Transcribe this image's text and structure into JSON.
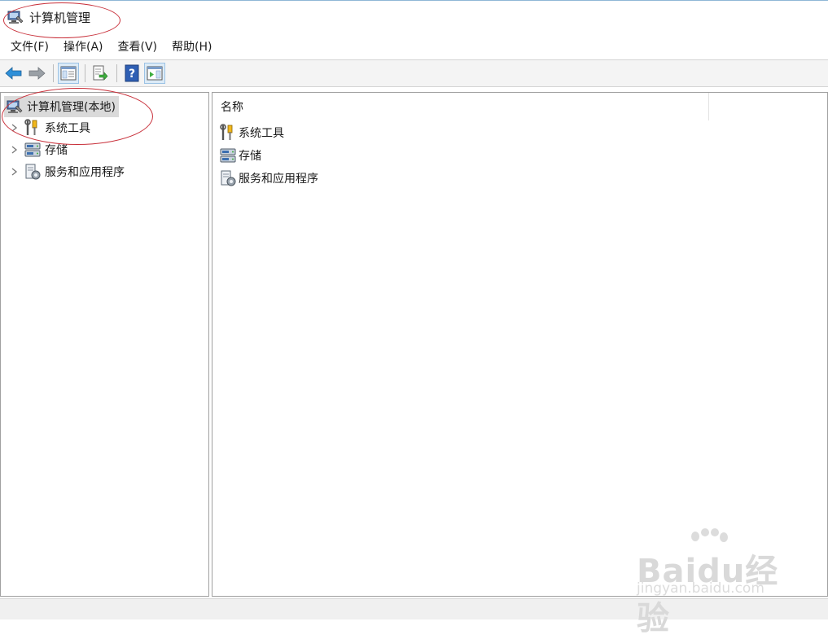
{
  "window": {
    "title": "计算机管理"
  },
  "menubar": {
    "items": [
      {
        "label": "文件(F)"
      },
      {
        "label": "操作(A)"
      },
      {
        "label": "查看(V)"
      },
      {
        "label": "帮助(H)"
      }
    ]
  },
  "toolbar": {
    "buttons": [
      "back-arrow-icon",
      "forward-arrow-icon",
      "show-hide-console-tree-icon",
      "export-list-icon",
      "help-icon",
      "show-hide-action-pane-icon"
    ]
  },
  "tree": {
    "root": {
      "label": "计算机管理(本地)",
      "icon": "computer-management-icon"
    },
    "children": [
      {
        "label": "系统工具",
        "icon": "system-tools-icon"
      },
      {
        "label": "存储",
        "icon": "storage-icon"
      },
      {
        "label": "服务和应用程序",
        "icon": "services-apps-icon"
      }
    ]
  },
  "list": {
    "column_name": "名称",
    "items": [
      {
        "label": "系统工具",
        "icon": "system-tools-icon"
      },
      {
        "label": "存储",
        "icon": "storage-icon"
      },
      {
        "label": "服务和应用程序",
        "icon": "services-apps-icon"
      }
    ]
  },
  "watermark": {
    "logo": "Baidu经验",
    "url": "jingyan.baidu.com"
  },
  "colors": {
    "annotation": "#c8303a",
    "arrow_blue": "#2e8fd8",
    "arrow_gray": "#9aa0a6",
    "help_blue": "#2f5fb4"
  }
}
